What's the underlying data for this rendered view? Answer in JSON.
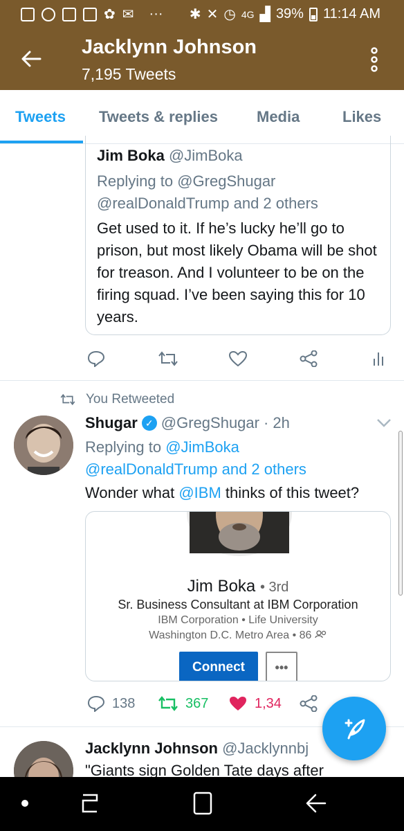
{
  "status_bar": {
    "network": "4G",
    "battery": "39%",
    "time": "11:14 AM"
  },
  "header": {
    "title": "Jacklynn Johnson",
    "subtitle": "7,195 Tweets"
  },
  "tabs": [
    {
      "label": "Tweets",
      "active": true
    },
    {
      "label": "Tweets & replies",
      "active": false
    },
    {
      "label": "Media",
      "active": false
    },
    {
      "label": "Likes",
      "active": false
    }
  ],
  "quoted_tweet": {
    "name": "Jim Boka",
    "handle": "@JimBoka",
    "replying_to_prefix": "Replying to",
    "replying_to": "@GregShugar",
    "replying_to_more": "@realDonaldTrump and 2 others",
    "text": "Get used to it. If he’s lucky he’ll go to prison, but most likely Obama will be shot for treason. And I volunteer to be on the firing squad. I’ve been saying this for 10 years."
  },
  "retweet_tweet": {
    "retweeted_label": "You Retweeted",
    "name": "Shugar",
    "handle": "@GregShugar",
    "time": "· 2h",
    "replying_to_prefix": "Replying to",
    "replying_to": "@JimBoka",
    "replying_to_more": "@realDonaldTrump and 2 others",
    "text_pre": "Wonder what",
    "text_link": "@IBM",
    "text_post": "thinks of this tweet?",
    "card": {
      "name": "Jim Boka",
      "degree": "3rd",
      "title": "Sr. Business Consultant at IBM Corporation",
      "orgs": "IBM Corporation • Life University",
      "location": "Washington D.C. Metro Area • 86",
      "connect_label": "Connect",
      "more_label": "•••"
    },
    "replies": "138",
    "retweets": "367",
    "likes": "1,34"
  },
  "next_tweet": {
    "name": "Jacklynn Johnson",
    "handle": "@Jacklynnbj",
    "text": "\"Giants sign Golden Tate days after"
  },
  "colors": {
    "brand_bar": "#7a5a2c",
    "accent": "#1da1f2",
    "retweet_green": "#17bf63",
    "like_red": "#e0245e",
    "linkedin_blue": "#0a66c2"
  }
}
